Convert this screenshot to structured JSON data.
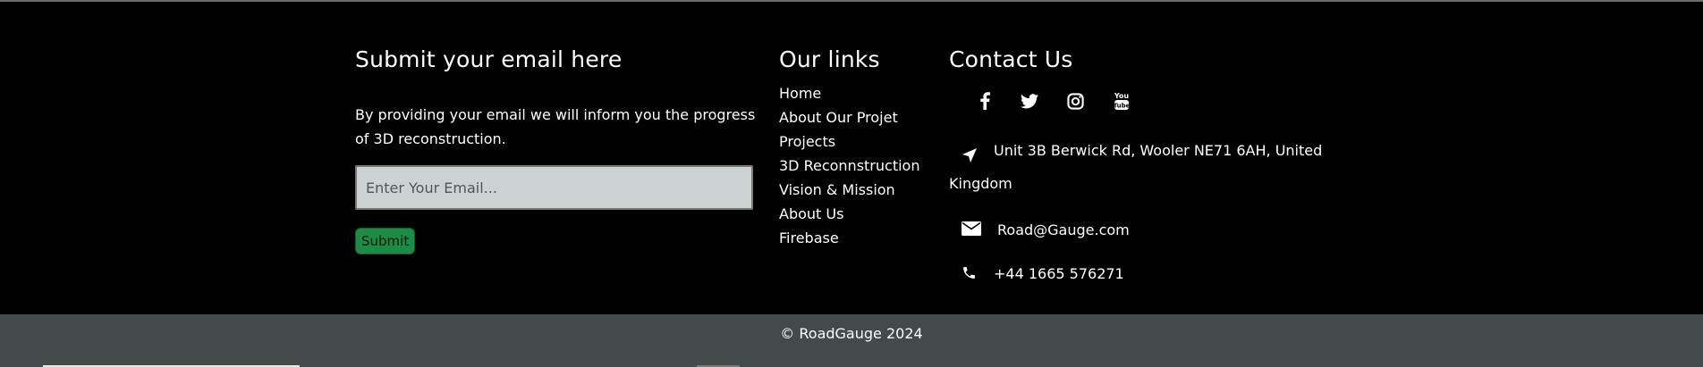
{
  "email_section": {
    "title": "Submit your email here",
    "description": "By providing your email we will inform you the progress of 3D reconstruction.",
    "input_placeholder": "Enter Your Email...",
    "submit_label": "Submit"
  },
  "links_section": {
    "title": "Our links",
    "items": [
      {
        "label": "Home"
      },
      {
        "label": "About Our Projet"
      },
      {
        "label": "Projects"
      },
      {
        "label": "3D Reconnstruction"
      },
      {
        "label": "Vision & Mission"
      },
      {
        "label": "About Us"
      },
      {
        "label": "Firebase"
      }
    ]
  },
  "contact_section": {
    "title": "Contact Us",
    "social_icons": [
      "facebook-icon",
      "twitter-icon",
      "instagram-icon",
      "youtube-icon"
    ],
    "address": "Unit 3B Berwick Rd, Wooler NE71 6AH, United Kingdom",
    "email": "Road@Gauge.com",
    "phone": "+44 1665 576271"
  },
  "footer": {
    "copyright": "© RoadGauge 2024"
  },
  "colors": {
    "background": "#000000",
    "bottom_bar": "#434a4a",
    "input_bg": "#cdd2d2",
    "submit_bg": "#1d8a45"
  }
}
